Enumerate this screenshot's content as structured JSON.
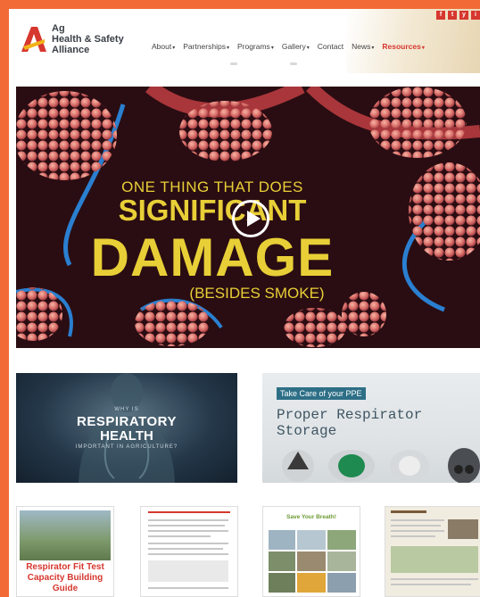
{
  "brand": {
    "line1": "Ag",
    "line2": "Health & Safety",
    "line3": "Alliance",
    "accent": "#d6372e",
    "frame": "#f26a35"
  },
  "nav": {
    "items": [
      "About",
      "Partnerships",
      "Programs",
      "Gallery",
      "Contact",
      "News",
      "Resources"
    ]
  },
  "social": [
    "f",
    "t",
    "y",
    "i"
  ],
  "video": {
    "line1": "ONE THING THAT DOES",
    "line2": "SIGNIFICANT",
    "line3": "DAMAGE",
    "line4": "(BESIDES SMOKE)",
    "text_color": "#e8cf37"
  },
  "thumb_resp_health": {
    "why": "WHY IS",
    "title1": "RESPIRATORY",
    "title2": "HEALTH",
    "sub": "IMPORTANT IN AGRICULTURE?"
  },
  "thumb_storage": {
    "tag": "Take Care of your PPE",
    "title": "Proper Respirator Storage"
  },
  "docs": {
    "fit_test_title": "Respirator Fit Test Capacity Building Guide",
    "save_breath": "Save Your Breath!"
  }
}
